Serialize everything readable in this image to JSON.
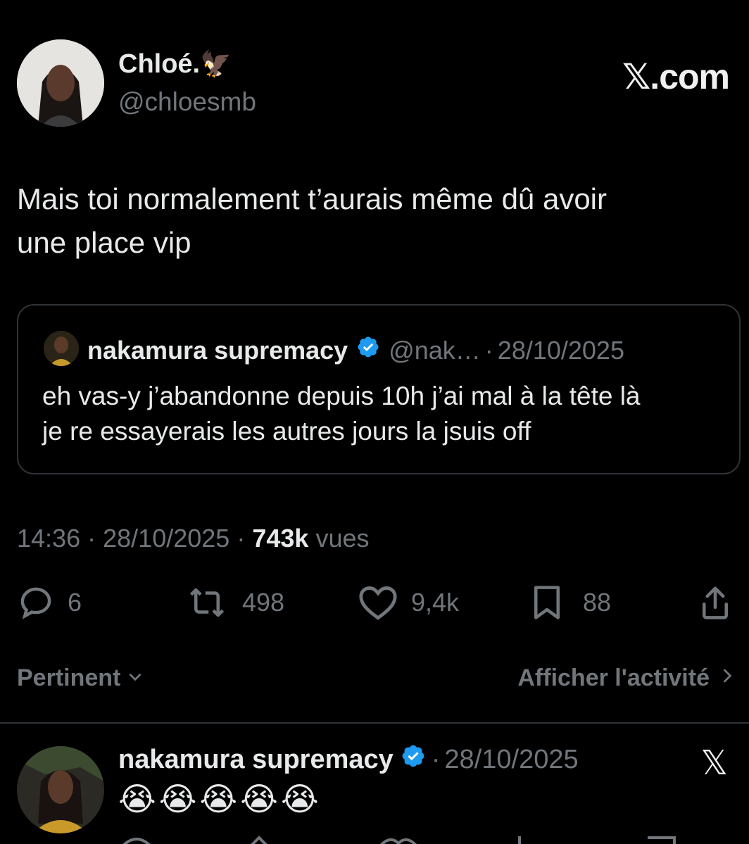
{
  "header": {
    "display_name": "Chloé.",
    "name_emoji": "🦅",
    "handle": "@chloesmb",
    "site_logo": "𝕏.com"
  },
  "tweet": {
    "text_line1": "Mais toi normalement t’aurais même dû avoir",
    "text_line2": "une place vip"
  },
  "quote": {
    "name": "nakamura supremacy",
    "handle": "@nak…",
    "sep": "·",
    "date": "28/10/2025",
    "text_line1": "eh vas-y j’abandonne depuis 10h j’ai mal à la tête là",
    "text_line2": "je re essayerais les autres jours la jsuis off"
  },
  "meta": {
    "time": "14:36",
    "sep1": "·",
    "date": "28/10/2025",
    "sep2": "·",
    "views_count": "743k",
    "views_label": "vues"
  },
  "actions": {
    "replies": "6",
    "retweets": "498",
    "likes": "9,4k",
    "bookmarks": "88"
  },
  "sort": {
    "label": "Pertinent",
    "activity_label": "Afficher l'activité"
  },
  "reply": {
    "name": "nakamura supremacy",
    "sep": "·",
    "date": "28/10/2025",
    "text": "😭😭😭😭😭",
    "logo": "𝕏"
  },
  "colors": {
    "background": "#000000",
    "text": "#e7e9ea",
    "muted": "#71767b",
    "verified_blue": "#1d9bf0",
    "border": "#2f3336"
  }
}
